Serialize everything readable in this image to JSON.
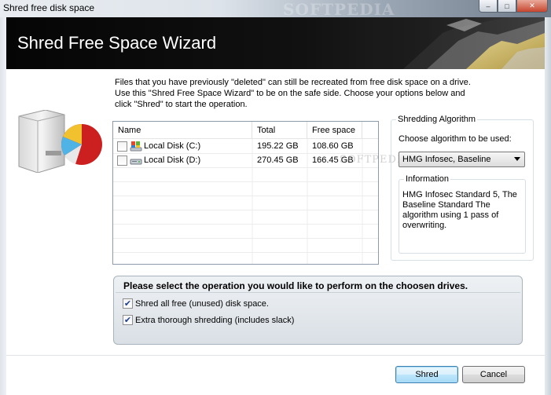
{
  "window": {
    "title": "Shred free disk space",
    "watermark": "SOFTPEDIA"
  },
  "banner": {
    "heading": "Shred Free Space Wizard"
  },
  "intro": {
    "text": "Files that you have previously \"deleted\" can still be recreated from free disk space on a drive. Use this \"Shred Free Space Wizard\" to be on the safe side. Choose your options below and click \"Shred\" to start the operation."
  },
  "drives": {
    "columns": [
      "Name",
      "Total",
      "Free space"
    ],
    "rows": [
      {
        "name": "Local Disk (C:)",
        "total": "195.22 GB",
        "free": "108.60 GB",
        "checked": false
      },
      {
        "name": "Local Disk (D:)",
        "total": "270.45 GB",
        "free": "166.45 GB",
        "checked": false
      }
    ]
  },
  "algorithm": {
    "group_label": "Shredding Algorithm",
    "choose_label": "Choose algorithm to be used:",
    "selected": "HMG Infosec, Baseline",
    "info_label": "Information",
    "info_text": "HMG Infosec Standard 5, The Baseline Standard The algorithm using 1 pass of overwriting."
  },
  "operation": {
    "title": "Please select the operation you would like to perform on the choosen drives.",
    "options": [
      {
        "label": "Shred all free (unused) disk space.",
        "checked": true
      },
      {
        "label": "Extra thorough shredding (includes slack)",
        "checked": true
      }
    ]
  },
  "buttons": {
    "shred": "Shred",
    "cancel": "Cancel"
  },
  "colors": {
    "banner": "#0a0a0a",
    "accent_button": "#3c7fb1",
    "folder_deco": "#e8d27a"
  }
}
